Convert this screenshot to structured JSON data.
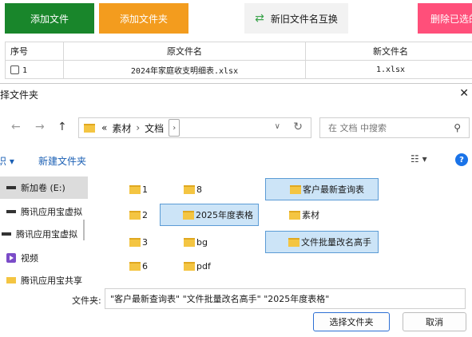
{
  "app": {
    "add_file_label": "添加文件",
    "add_folder_label": "添加文件夹",
    "swap_label": "新旧文件名互换",
    "delete_label": "删除已选的",
    "table": {
      "headers": [
        "序号",
        "原文件名",
        "新文件名"
      ],
      "rows": [
        {
          "index": "1",
          "old_name": "2024年家庭收支明细表.xlsx",
          "new_name": "1.xlsx"
        }
      ]
    },
    "colors": {
      "add_file": "#19862b",
      "add_folder": "#f39c1e",
      "delete": "#ff4f7a"
    }
  },
  "dialog": {
    "title": "择文件夹",
    "address": {
      "prefix": "«",
      "crumbs": [
        "素材",
        "文档"
      ]
    },
    "search_placeholder": "在 文档 中搜索",
    "toolbar": {
      "organize": "识 ▾",
      "new_folder": "新建文件夹"
    },
    "nav_items": [
      "新加卷 (E:)",
      "腾讯应用宝虚拟",
      "腾讯应用宝虚拟",
      "视频",
      "腾讯应用宝共享"
    ],
    "folders": [
      "1",
      "8",
      "客户最新查询表",
      "2",
      "2025年度表格",
      "素材",
      "3",
      "bg",
      "文件批量改名高手",
      "6",
      "pdf"
    ],
    "selected_folders": [
      "客户最新查询表",
      "2025年度表格",
      "文件批量改名高手"
    ],
    "footer": {
      "label": "文件夹:",
      "value": "\"客户最新查询表\" \"文件批量改名高手\" \"2025年度表格\"",
      "ok_label": "选择文件夹",
      "cancel_label": "取消"
    }
  }
}
